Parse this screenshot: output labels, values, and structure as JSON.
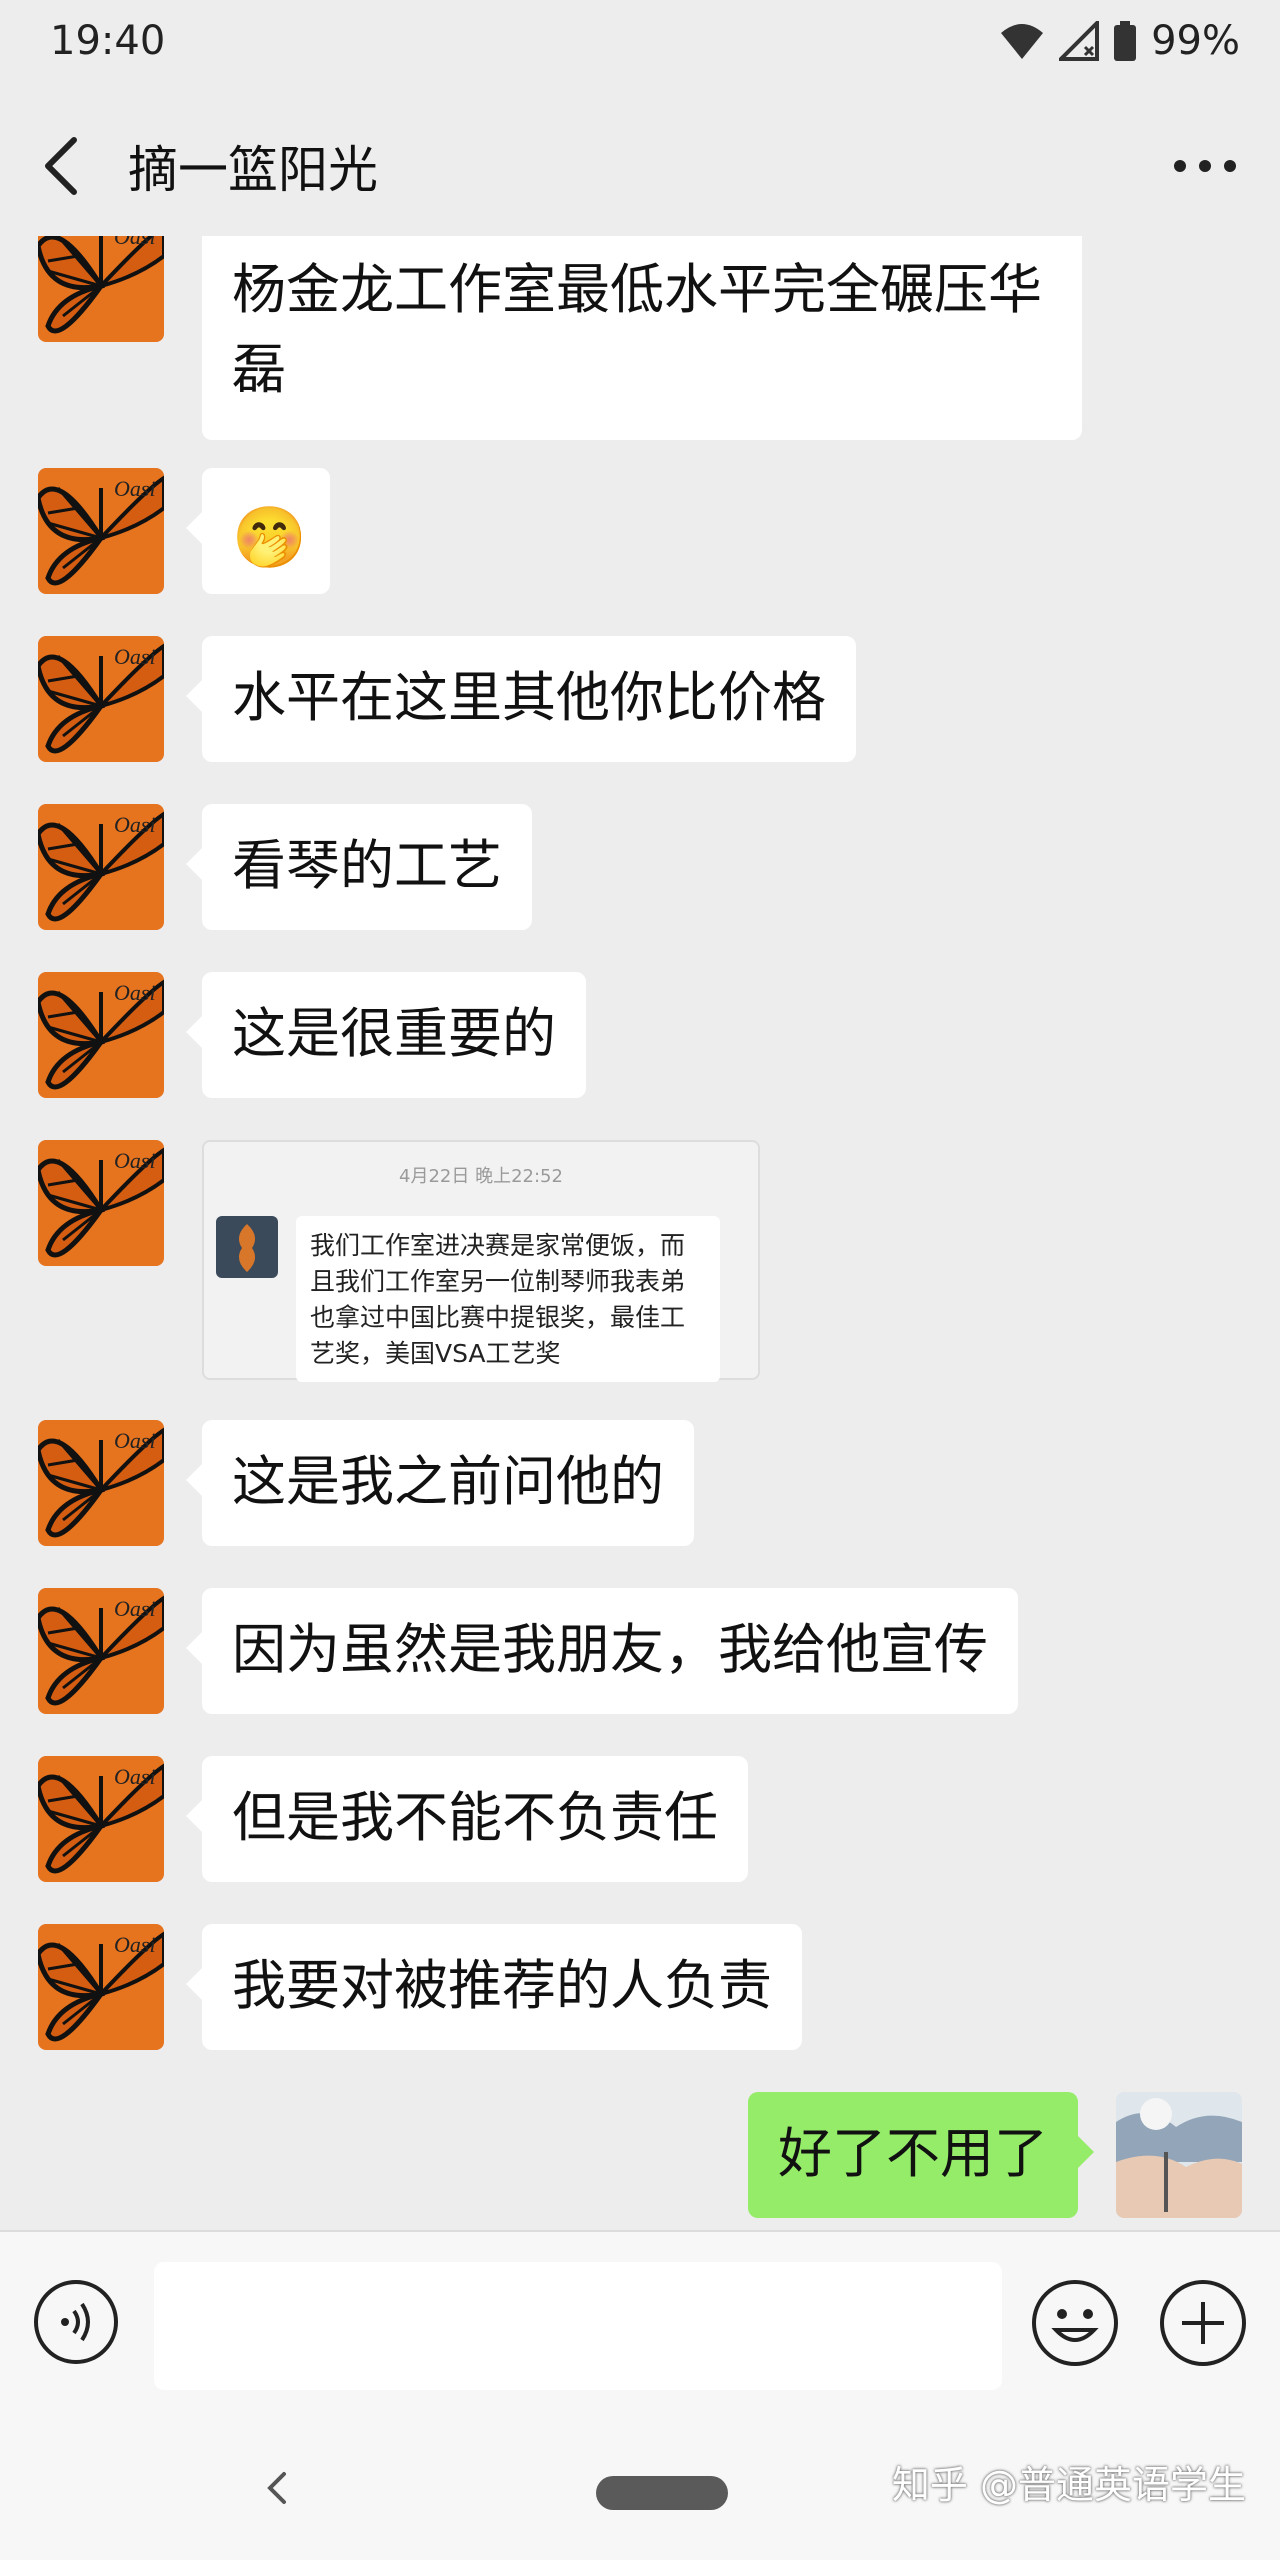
{
  "status_bar": {
    "time": "19:40",
    "battery": "99%",
    "icons": [
      "wifi-icon",
      "signal-icon",
      "battery-icon"
    ]
  },
  "nav": {
    "title": "摘一篮阳光",
    "back_icon": "chevron-left-icon",
    "more_icon": "more-horizontal-icon"
  },
  "messages": [
    {
      "side": "received",
      "type": "text",
      "text": "杨金龙工作室最低水平完全碾压华磊"
    },
    {
      "side": "received",
      "type": "emoji",
      "emoji": "🤭"
    },
    {
      "side": "received",
      "type": "text",
      "text": "水平在这里其他你比价格"
    },
    {
      "side": "received",
      "type": "text",
      "text": "看琴的工艺"
    },
    {
      "side": "received",
      "type": "text",
      "text": "这是很重要的"
    },
    {
      "side": "received",
      "type": "image",
      "card": {
        "timestamp": "4月22日 晚上22:52",
        "text": "我们工作室进决赛是家常便饭，而且我们工作室另一位制琴师我表弟也拿过中国比赛中提银奖，最佳工艺奖，美国VSA工艺奖"
      }
    },
    {
      "side": "received",
      "type": "text",
      "text": "这是我之前问他的"
    },
    {
      "side": "received",
      "type": "text",
      "text": "因为虽然是我朋友，我给他宣传"
    },
    {
      "side": "received",
      "type": "text",
      "text": "但是我不能不负责任"
    },
    {
      "side": "received",
      "type": "text",
      "text": "我要对被推荐的人负责"
    },
    {
      "side": "sent",
      "type": "text",
      "text": "好了不用了"
    }
  ],
  "input_bar": {
    "voice_icon": "voice-icon",
    "emoji_icon": "emoji-icon",
    "plus_icon": "plus-icon",
    "placeholder": ""
  },
  "system_nav": {
    "back_icon": "chevron-left-icon",
    "home_icon": "home-pill-icon"
  },
  "watermark": "知乎 @普通英语学生",
  "colors": {
    "background": "#ededed",
    "received_bubble": "#ffffff",
    "sent_bubble": "#95ec69",
    "avatar_orange": "#e07020"
  }
}
